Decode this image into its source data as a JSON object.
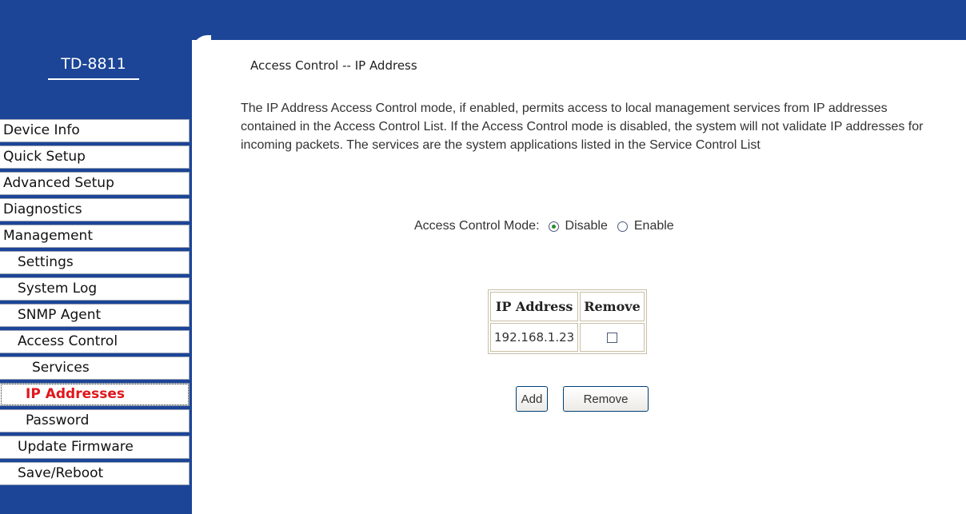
{
  "brand": {
    "name": "TD-8811"
  },
  "sidebar": {
    "items": [
      {
        "label": "Device Info",
        "level": 0,
        "active": false
      },
      {
        "label": "Quick Setup",
        "level": 0,
        "active": false
      },
      {
        "label": "Advanced Setup",
        "level": 0,
        "active": false
      },
      {
        "label": "Diagnostics",
        "level": 0,
        "active": false
      },
      {
        "label": "Management",
        "level": 0,
        "active": false
      },
      {
        "label": "Settings",
        "level": 1,
        "active": false
      },
      {
        "label": "System Log",
        "level": 1,
        "active": false
      },
      {
        "label": "SNMP Agent",
        "level": 1,
        "active": false
      },
      {
        "label": "Access Control",
        "level": 1,
        "active": false
      },
      {
        "label": "Services",
        "level": 2,
        "active": false
      },
      {
        "label": "IP Addresses",
        "level": 2,
        "active": true
      },
      {
        "label": "Password",
        "level": 2,
        "active": false
      },
      {
        "label": "Update Firmware",
        "level": 1,
        "active": false
      },
      {
        "label": "Save/Reboot",
        "level": 1,
        "active": false
      }
    ]
  },
  "main": {
    "title": "Access Control -- IP Address",
    "description": "The IP Address Access Control mode, if enabled, permits access to local management services from IP addresses contained in the Access Control List. If the Access Control mode is disabled, the system will not validate IP addresses for incoming packets. The services are the system applications listed in the Service Control List",
    "mode": {
      "label": "Access Control Mode:",
      "options": [
        {
          "label": "Disable",
          "checked": true
        },
        {
          "label": "Enable",
          "checked": false
        }
      ]
    },
    "table": {
      "headers": [
        "IP Address",
        "Remove"
      ],
      "rows": [
        {
          "ip": "192.168.1.23",
          "remove_checked": false
        }
      ]
    },
    "buttons": {
      "add": "Add",
      "remove": "Remove"
    }
  },
  "colors": {
    "frame": "#1C4597",
    "active_text": "#E0161B"
  }
}
